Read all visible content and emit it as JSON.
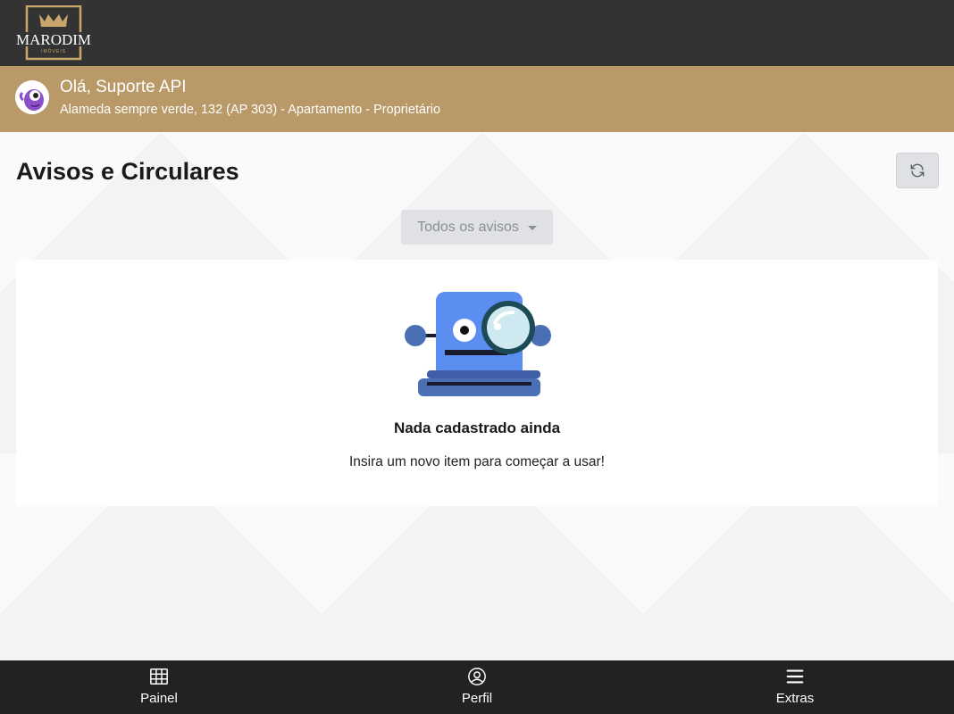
{
  "brand": {
    "name": "MARODIM",
    "tagline": "IMÓVEIS",
    "logo_color": "#c9a66b"
  },
  "user": {
    "greeting": "Olá, Suporte API",
    "address": "Alameda sempre verde, 132 (AP 303) - Apartamento - Proprietário",
    "avatar_icon": "purple-monster-avatar"
  },
  "page": {
    "title": "Avisos e Circulares",
    "refresh_icon": "refresh-icon"
  },
  "filter": {
    "selected": "Todos os avisos"
  },
  "empty_state": {
    "title": "Nada cadastrado ainda",
    "subtitle": "Insira um novo item para começar a usar!",
    "illustration": "robot-magnifier-illustration"
  },
  "nav": {
    "items": [
      {
        "label": "Painel",
        "icon": "grid-icon"
      },
      {
        "label": "Perfil",
        "icon": "user-circle-icon"
      },
      {
        "label": "Extras",
        "icon": "menu-icon"
      }
    ]
  },
  "colors": {
    "topbar": "#333333",
    "userbar": "#b99968",
    "bottomnav": "#222222",
    "robot_blue": "#5b8ef0"
  }
}
